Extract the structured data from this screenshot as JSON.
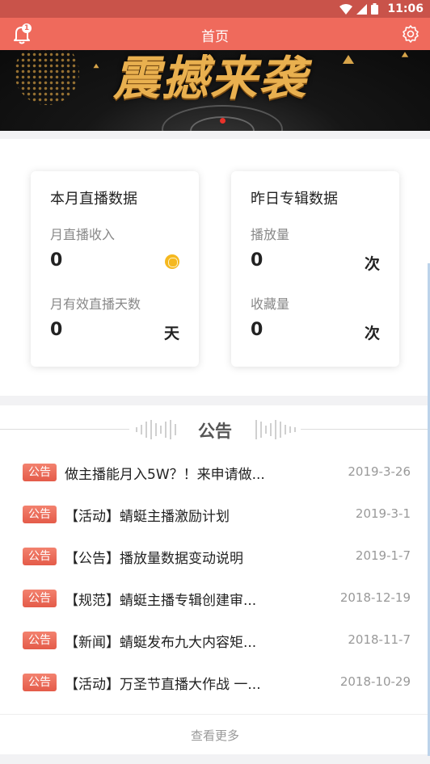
{
  "status_bar": {
    "time": "11:06",
    "icons": [
      "wifi-icon",
      "signal-icon",
      "battery-icon"
    ]
  },
  "header": {
    "title": "首页",
    "bell_badge": "1",
    "icons": [
      "bell-icon",
      "gear-icon"
    ]
  },
  "banner": {
    "text": "震撼来袭"
  },
  "stats": {
    "live": {
      "title": "本月直播数据",
      "income_label": "月直播收入",
      "income_value": "0",
      "days_label": "月有效直播天数",
      "days_value": "0",
      "days_unit": "天"
    },
    "album": {
      "title": "昨日专辑数据",
      "plays_label": "播放量",
      "plays_value": "0",
      "plays_unit": "次",
      "fav_label": "收藏量",
      "fav_value": "0",
      "fav_unit": "次"
    }
  },
  "announcements": {
    "title": "公告",
    "items": [
      {
        "tag": "公告",
        "text": "做主播能月入5W？！来申请做...",
        "date": "2019-3-26"
      },
      {
        "tag": "公告",
        "text": "【活动】蜻蜓主播激励计划",
        "date": "2019-3-1"
      },
      {
        "tag": "公告",
        "text": "【公告】播放量数据变动说明",
        "date": "2019-1-7"
      },
      {
        "tag": "公告",
        "text": "【规范】蜻蜓主播专辑创建审...",
        "date": "2018-12-19"
      },
      {
        "tag": "公告",
        "text": "【新闻】蜻蜓发布九大内容矩...",
        "date": "2018-11-7"
      },
      {
        "tag": "公告",
        "text": "【活动】万圣节直播大作战 一...",
        "date": "2018-10-29"
      }
    ],
    "more_label": "查看更多"
  },
  "colors": {
    "primary": "#ef6a5c",
    "status_bar": "#c9534a",
    "coin": "#f5b81f"
  }
}
